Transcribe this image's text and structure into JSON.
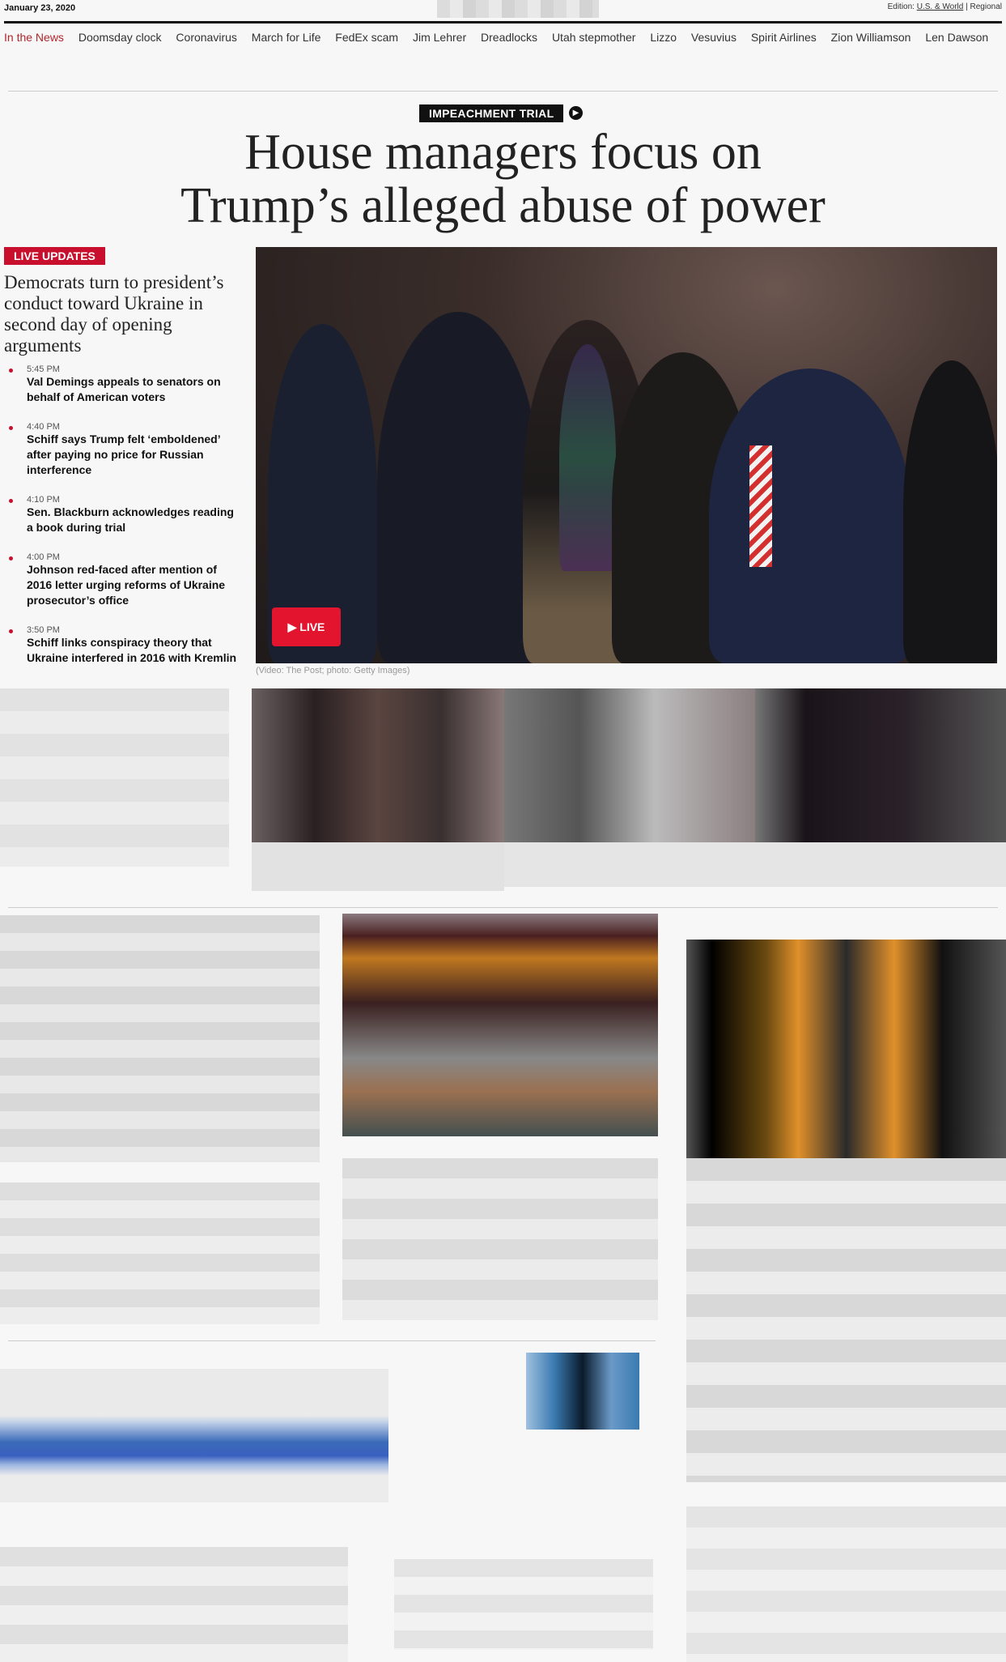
{
  "topbar": {
    "date": "January 23, 2020",
    "edition_prefix": "Edition:",
    "edition_us": "U.S. & World",
    "edition_sep": "|",
    "edition_regional": "Regional"
  },
  "nav": {
    "items": [
      "In the News",
      "Doomsday clock",
      "Coronavirus",
      "March for Life",
      "FedEx scam",
      "Jim Lehrer",
      "Dreadlocks",
      "Utah stepmother",
      "Lizzo",
      "Vesuvius",
      "Spirit Airlines",
      "Zion Williamson",
      "Len Dawson"
    ]
  },
  "lead": {
    "kicker": "IMPEACHMENT TRIAL",
    "headline_line1": "House managers focus on",
    "headline_line2": "Trump’s alleged abuse of power",
    "live_badge": "LIVE UPDATES",
    "sub_headline": "Democrats turn to president’s conduct toward Ukraine in second day of opening arguments",
    "updates": [
      {
        "time": "5:45 PM",
        "text": "Val Demings appeals to senators on behalf of American voters"
      },
      {
        "time": "4:40 PM",
        "text": "Schiff says Trump felt ‘emboldened’ after paying no price for Russian interference"
      },
      {
        "time": "4:10 PM",
        "text": "Sen. Blackburn acknowledges reading a book during trial"
      },
      {
        "time": "4:00 PM",
        "text": "Johnson red-faced after mention of 2016 letter urging reforms of Ukraine prosecutor’s office"
      },
      {
        "time": "3:50 PM",
        "text": "Schiff links conspiracy theory that Ukraine interfered in 2016 with Kremlin"
      }
    ],
    "live_button": "LIVE",
    "caption": "(Video: The Post; photo: Getty Images)"
  }
}
